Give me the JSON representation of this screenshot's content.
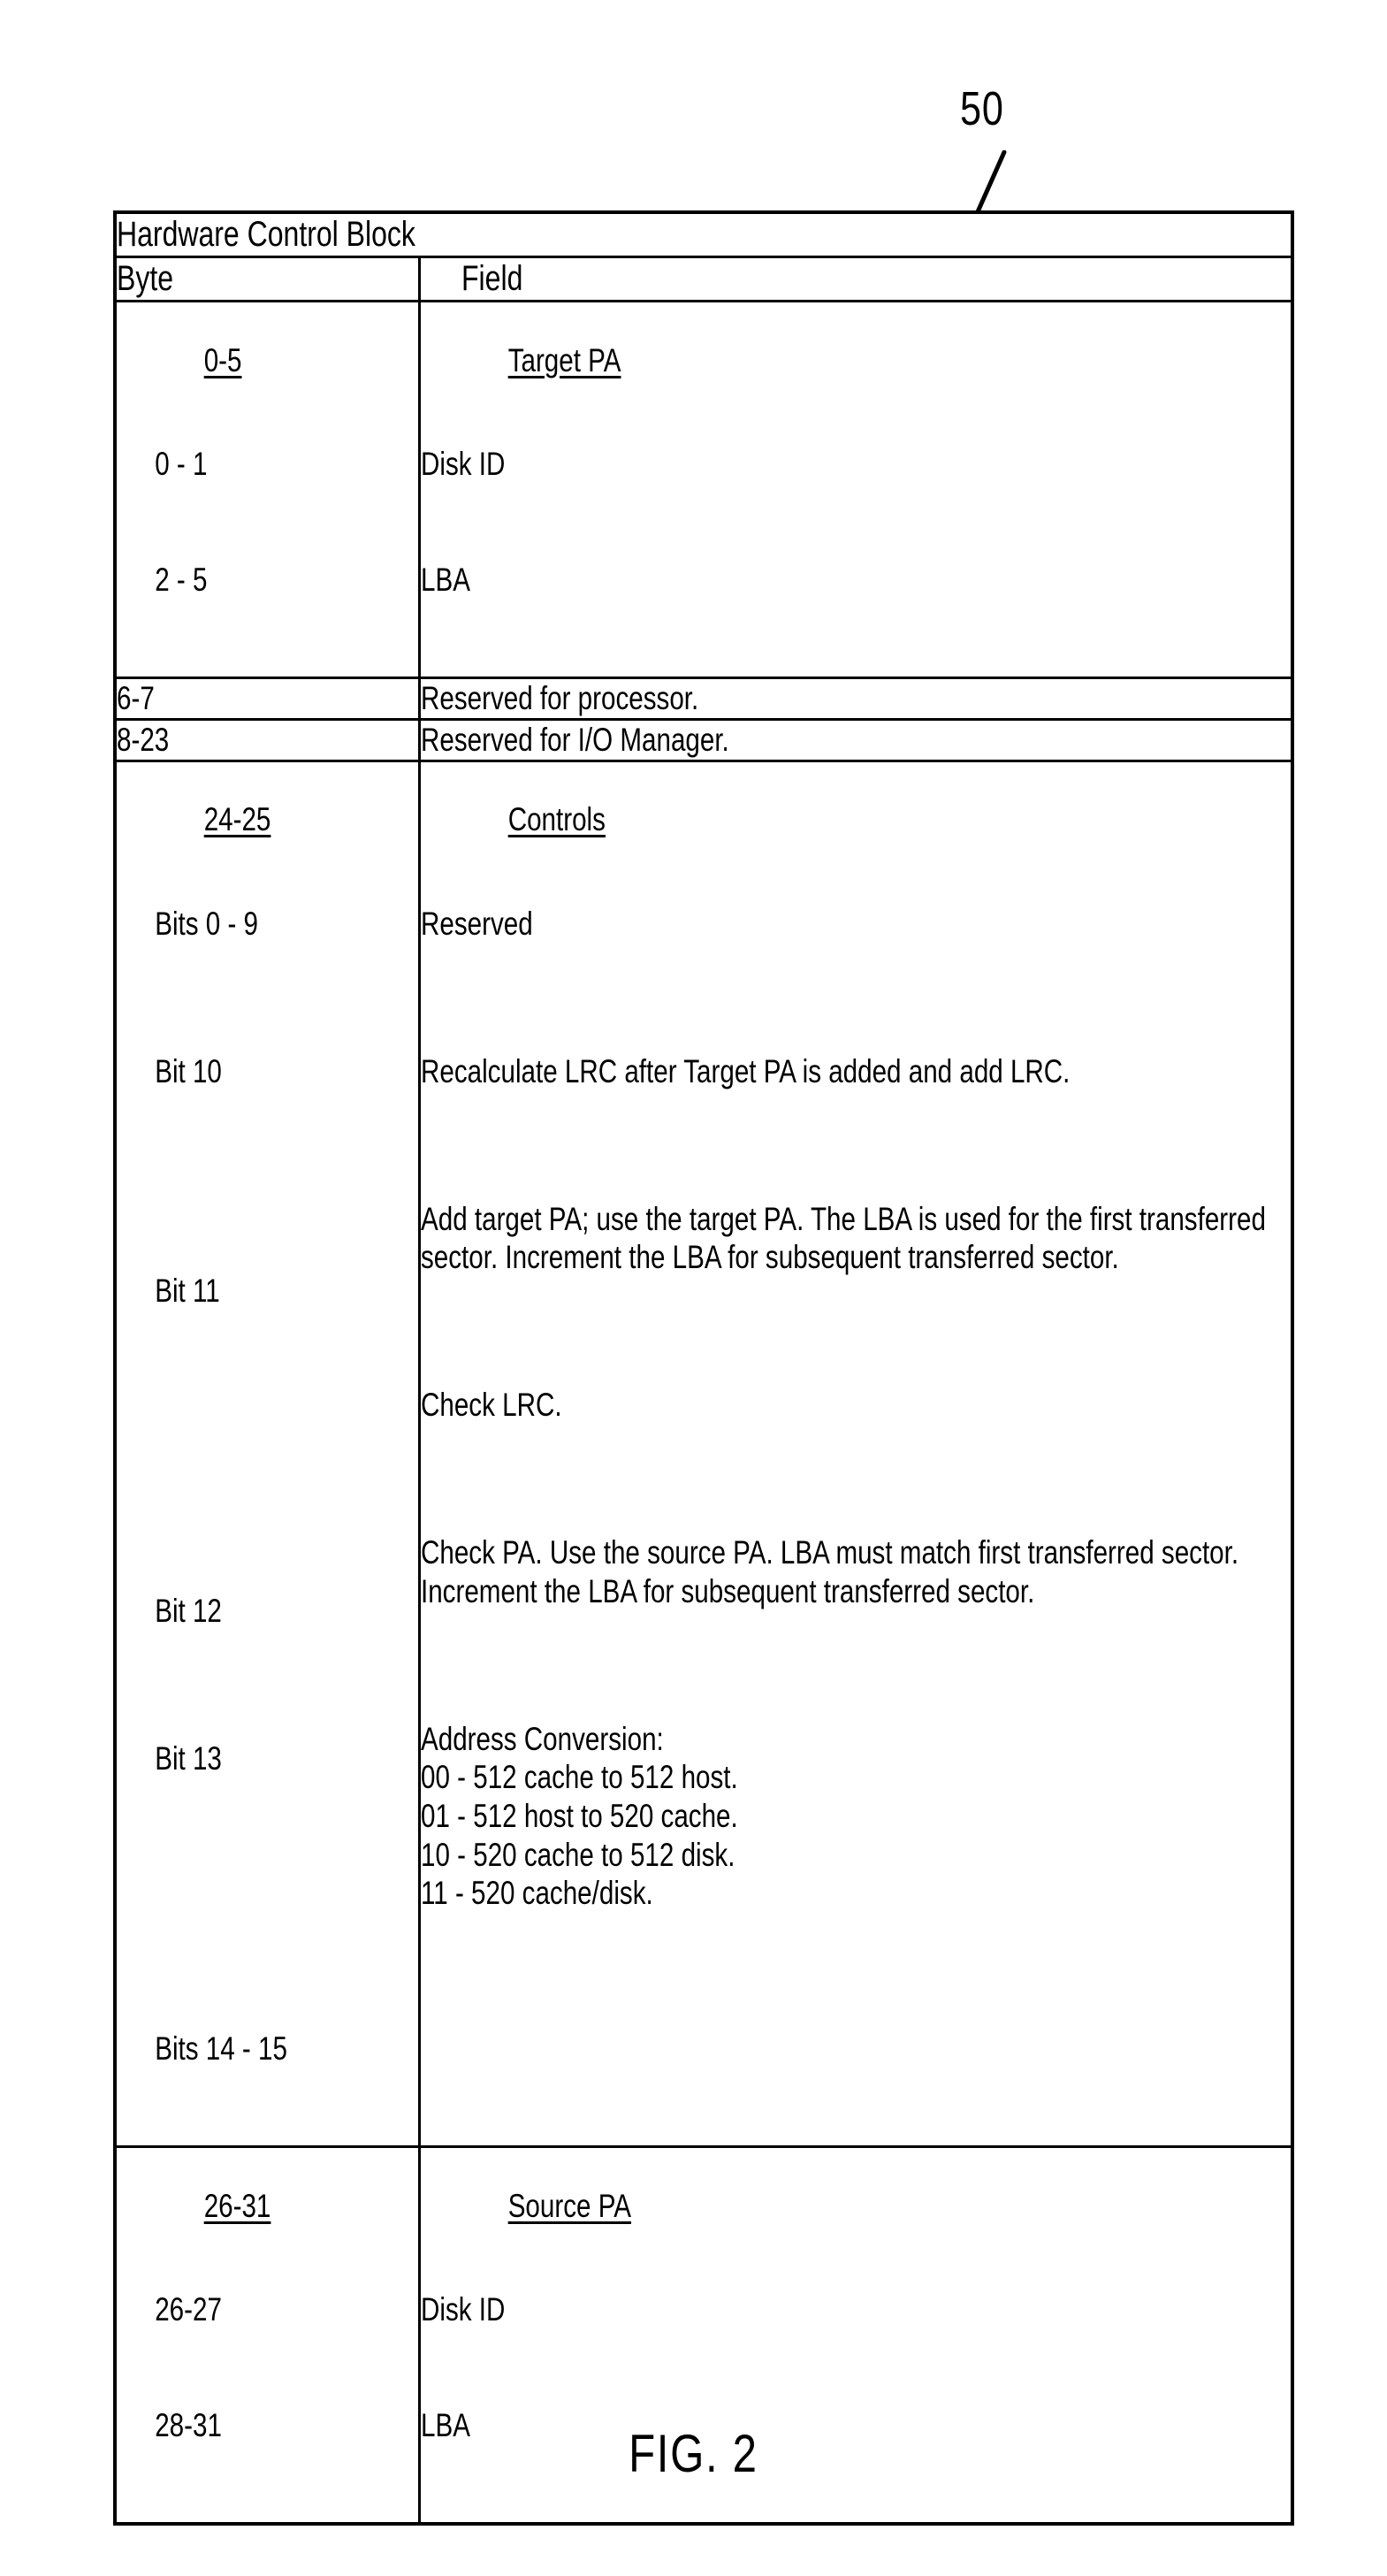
{
  "figure": {
    "reference_numeral": "50",
    "caption": "FIG. 2"
  },
  "table": {
    "title": "Hardware Control Block",
    "columns": {
      "byte": "Byte",
      "field": "Field"
    },
    "rows": [
      {
        "byte": "0-5",
        "byte_underline": true,
        "byte_sub": [
          "0 - 1",
          "2 - 5"
        ],
        "field": "Target PA",
        "field_underline": true,
        "field_sub": [
          "Disk ID",
          "LBA"
        ]
      },
      {
        "byte": "6-7",
        "byte_underline": false,
        "byte_sub": [],
        "field": "Reserved for processor.",
        "field_underline": false,
        "field_sub": []
      },
      {
        "byte": "8-23",
        "byte_underline": false,
        "byte_sub": [],
        "field": "Reserved for I/O Manager.",
        "field_underline": false,
        "field_sub": []
      },
      {
        "byte": "24-25",
        "byte_underline": true,
        "byte_sub": [],
        "field": "Controls",
        "field_underline": true,
        "field_sub": [],
        "bits": [
          {
            "byte": "Bits 0 - 9",
            "field": "Reserved"
          },
          {
            "byte": "Bit 10",
            "field": "Recalculate LRC after Target PA is added and add LRC."
          },
          {
            "byte": "Bit 11",
            "field": "Add target PA; use the target PA. The LBA is used for the first transferred sector. Increment the LBA for subsequent transferred sector."
          },
          {
            "byte": "Bit 12",
            "field": "Check LRC."
          },
          {
            "byte": "Bit 13",
            "field": "Check PA. Use the source PA. LBA must match first transferred sector. Increment the LBA for subsequent transferred sector."
          },
          {
            "byte": "Bits 14 - 15",
            "field": "Address Conversion:\n00 - 512 cache to 512 host.\n01 - 512 host to 520 cache.\n10 - 520 cache to 512 disk.\n11 - 520 cache/disk."
          }
        ]
      },
      {
        "byte": "26-31",
        "byte_underline": true,
        "byte_sub": [
          "26-27",
          "28-31"
        ],
        "field": "Source PA",
        "field_underline": true,
        "field_sub": [
          "Disk ID",
          "LBA"
        ]
      }
    ]
  }
}
